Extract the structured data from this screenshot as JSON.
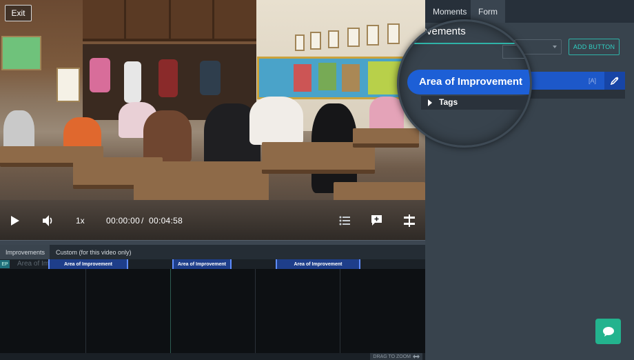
{
  "video": {
    "exit_label": "Exit",
    "speed": "1x",
    "current_time": "00:00:00",
    "separator": "/",
    "duration": "00:04:58"
  },
  "timeline": {
    "tabs": [
      {
        "label": "Improvements",
        "active": true
      },
      {
        "label": "Custom (for this video only)",
        "active": false
      }
    ],
    "ep_badge": "EP",
    "ghost_label": "Area of Imp",
    "markers": [
      "Area of Improvement",
      "Area of Improvement",
      "Area of Improvement"
    ],
    "zoom_hint": "DRAG TO ZOOM"
  },
  "panel": {
    "tabs": [
      {
        "label": "Moments",
        "active": false
      },
      {
        "label": "Form",
        "active": true
      }
    ],
    "section_title": "vements",
    "add_button_label": "ADD BUTTON",
    "item_label": "Area of Improvement",
    "item_shortcut": "[A]",
    "tags_label": "Tags"
  },
  "colors": {
    "accent_teal": "#2fb3a8",
    "item_blue": "#1d58c9",
    "chat_green": "#23b38e"
  },
  "icons": [
    "play-icon",
    "volume-icon",
    "list-icon",
    "add-note-icon",
    "split-icon",
    "pencil-icon",
    "chat-icon",
    "caret-right-icon",
    "chevron-down-icon"
  ]
}
